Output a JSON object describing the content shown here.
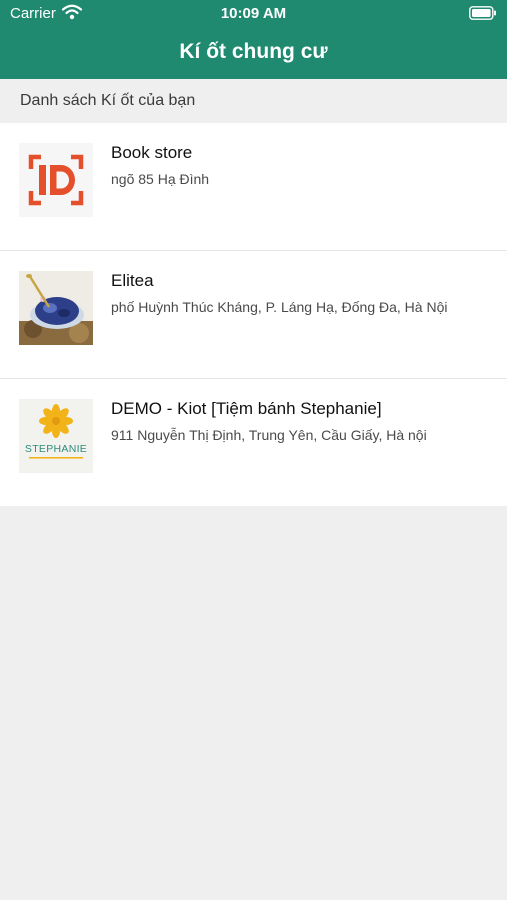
{
  "status_bar": {
    "carrier": "Carrier",
    "time": "10:09 AM",
    "wifi_icon": "wifi-icon",
    "battery_icon": "battery-icon"
  },
  "nav": {
    "title": "Kí ốt chung cư"
  },
  "section": {
    "title": "Danh sách Kí ốt của bạn"
  },
  "kiosks": [
    {
      "name": "Book store",
      "address": "ngõ 85 Hạ Đình",
      "thumbnail": "id-logo-thumbnail"
    },
    {
      "name": "Elitea",
      "address": "phố Huỳnh Thúc Kháng, P. Láng Hạ, Đống Đa, Hà Nội",
      "thumbnail": "tea-glass-thumbnail"
    },
    {
      "name": "DEMO - Kiot  [Tiệm bánh Stephanie]",
      "address": "911 Nguyễn Thị Định, Trung Yên, Cầu Giấy, Hà nội",
      "thumbnail": "stephanie-logo-thumbnail",
      "thumbnail_text": "STEPHANIE"
    }
  ],
  "colors": {
    "header_bg": "#1f8a70",
    "page_bg": "#efefef",
    "id_logo": "#e5502c",
    "stephanie_flower": "#f2b319",
    "stephanie_text": "#2e8c7b"
  }
}
